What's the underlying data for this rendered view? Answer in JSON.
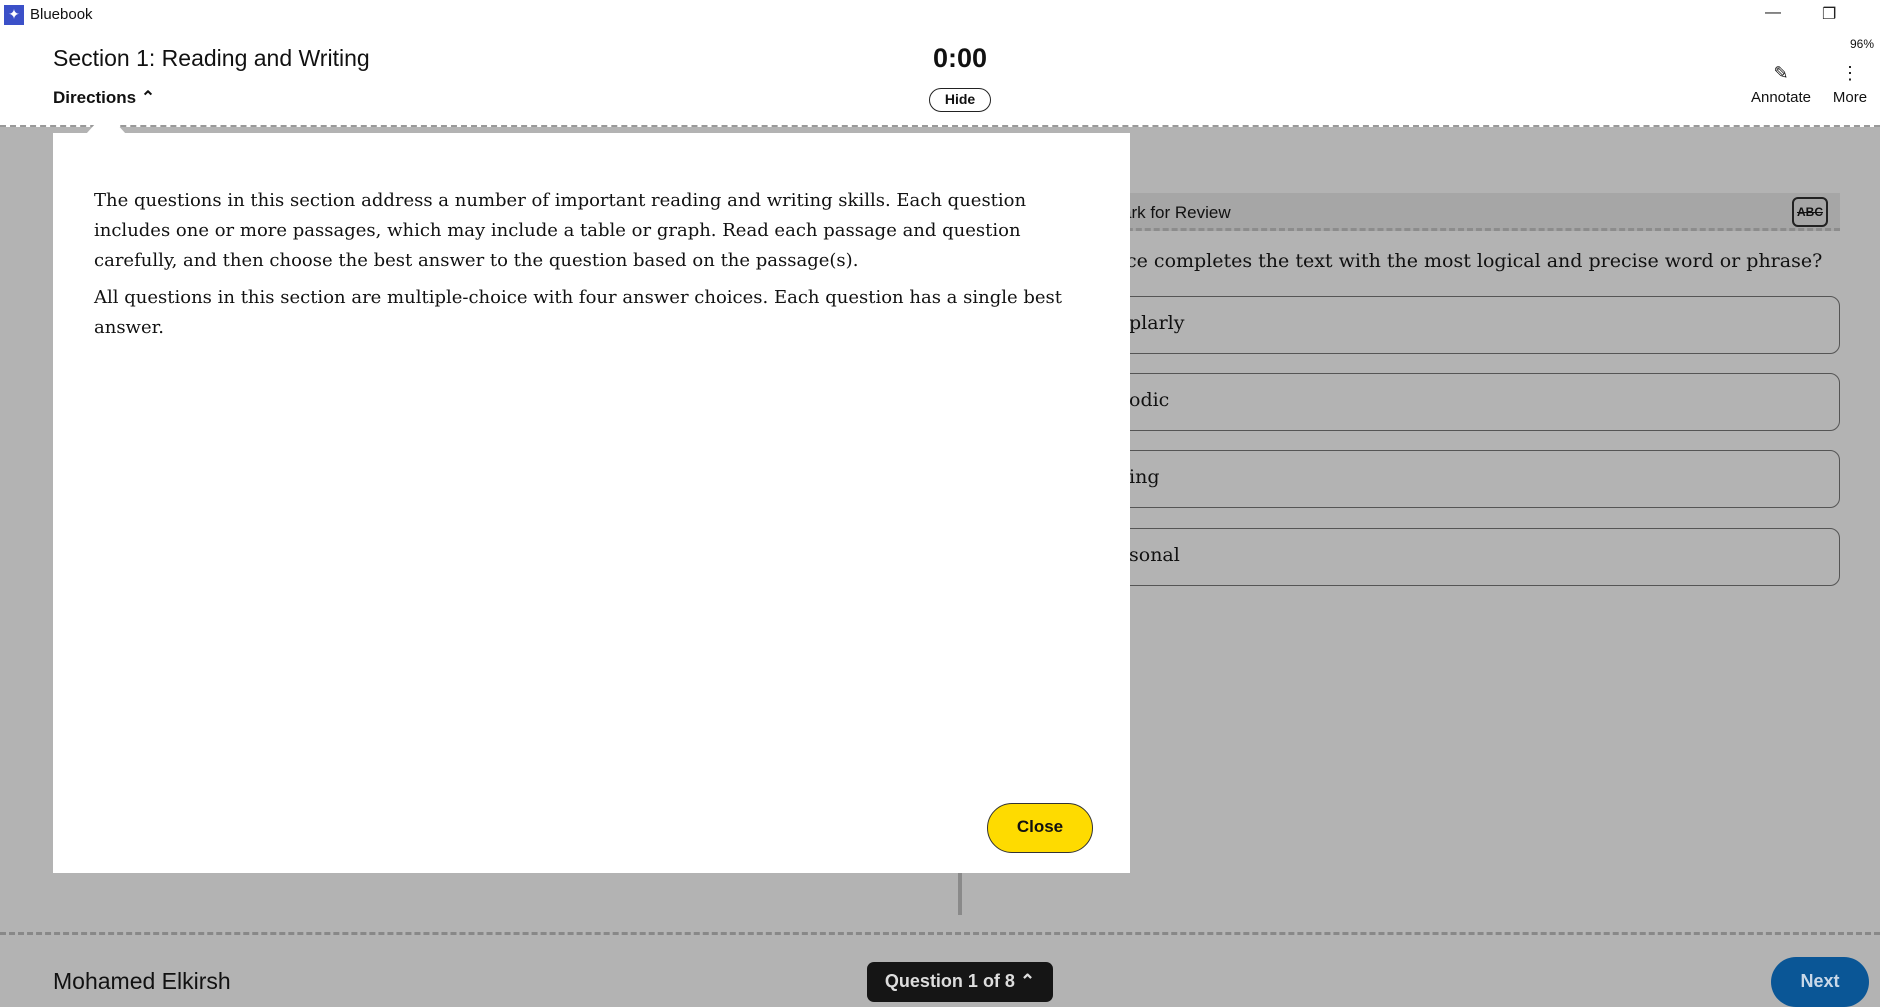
{
  "app": {
    "title": "Bluebook",
    "zoom": "96%"
  },
  "header": {
    "section_title": "Section 1: Reading and Writing",
    "directions_label": "Directions",
    "timer": "0:00",
    "hide_label": "Hide",
    "annotate_label": "Annotate",
    "more_label": "More"
  },
  "question": {
    "mark_for_review": "ark for Review",
    "abc_label": "ABC",
    "prompt": "ce completes the text with the most logical and precise word or phrase?",
    "options": [
      "plarly",
      "odic",
      "ing",
      "sonal"
    ]
  },
  "modal": {
    "paragraphs": [
      "The questions in this section address a number of important reading and writing skills. Each question includes one or more passages, which may include a table or graph. Read each passage and question carefully, and then choose the best answer to the question based on the passage(s).",
      "All questions in this section are multiple-choice with four answer choices. Each question has a single best answer."
    ],
    "close_label": "Close"
  },
  "footer": {
    "student_name": "Mohamed Elkirsh",
    "question_nav": "Question 1 of 8",
    "next_label": "Next"
  }
}
